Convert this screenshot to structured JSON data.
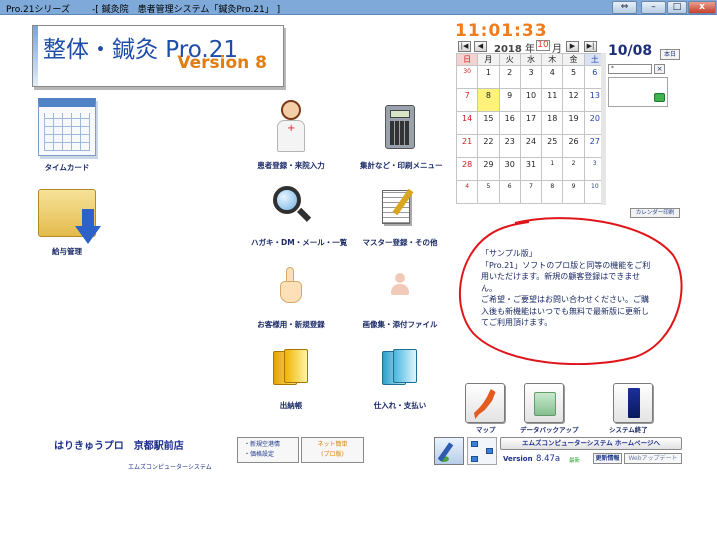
{
  "window": {
    "app_tab": "Pro.21シリーズ",
    "title": "-[ 鍼灸院　患者管理システム「鍼灸Pro.21」 ]",
    "controls": {
      "restore": "⇔",
      "minimize": "–",
      "maximize": "□",
      "close": "x"
    }
  },
  "logo": {
    "title": "整体・鍼灸 Pro.21",
    "version": "Version 8"
  },
  "menu": {
    "timecard": "タイムカード",
    "payroll": "給与管理",
    "patient_registration": "患者登録・来院入力",
    "aggregation_print": "集計など・印刷メニュー",
    "postcard_dm_mail": "ハガキ・DM・メール・一覧",
    "master_registration": "マスター登録・その他",
    "customer_booking": "お客様用・新規登録",
    "image_attachment": "画像集・添付ファイル",
    "ledger": "出納帳",
    "purchase_payment": "仕入れ・支払い"
  },
  "clock": {
    "time": "11:01:33"
  },
  "calendar": {
    "nav": {
      "first": "|◀",
      "prev": "◀",
      "next": "▶",
      "last": "▶|"
    },
    "year": "2018",
    "year_unit": "年",
    "month": "10",
    "month_unit": "月",
    "weekdays": [
      "日",
      "月",
      "火",
      "水",
      "木",
      "金",
      "土"
    ],
    "weeks": [
      [
        {
          "d": "30",
          "small": true
        },
        {
          "d": "1"
        },
        {
          "d": "2"
        },
        {
          "d": "3"
        },
        {
          "d": "4"
        },
        {
          "d": "5"
        },
        {
          "d": "6"
        }
      ],
      [
        {
          "d": "7"
        },
        {
          "d": "8"
        },
        {
          "d": "9"
        },
        {
          "d": "10"
        },
        {
          "d": "11"
        },
        {
          "d": "12"
        },
        {
          "d": "13"
        }
      ],
      [
        {
          "d": "14"
        },
        {
          "d": "15"
        },
        {
          "d": "16"
        },
        {
          "d": "17"
        },
        {
          "d": "18"
        },
        {
          "d": "19"
        },
        {
          "d": "20"
        }
      ],
      [
        {
          "d": "21"
        },
        {
          "d": "22"
        },
        {
          "d": "23"
        },
        {
          "d": "24"
        },
        {
          "d": "25"
        },
        {
          "d": "26"
        },
        {
          "d": "27"
        }
      ],
      [
        {
          "d": "28"
        },
        {
          "d": "29"
        },
        {
          "d": "30"
        },
        {
          "d": "31"
        },
        {
          "d": "1",
          "small": true
        },
        {
          "d": "2",
          "small": true
        },
        {
          "d": "3",
          "small": true
        }
      ],
      [
        {
          "d": "4",
          "small": true
        },
        {
          "d": "5",
          "small": true
        },
        {
          "d": "6",
          "small": true
        },
        {
          "d": "7",
          "small": true
        },
        {
          "d": "8",
          "small": true
        },
        {
          "d": "9",
          "small": true
        },
        {
          "d": "10",
          "small": true
        }
      ]
    ],
    "today_date": "10/08",
    "today_button": "本日",
    "memo_value": "*",
    "memo_clear": "×",
    "print_button": "カレンダー印刷"
  },
  "sample_note": {
    "lines": [
      "「サンプル版」",
      "「Pro.21」ソフトのプロ版と同等の機能をご利用いただけます。新規の顧客登録はできません。",
      "ご希望・ご要望はお問い合わせください。ご購入後も新機能はいつでも無料で最新版に更新してご利用頂けます。"
    ]
  },
  "tools": {
    "map": "マップ",
    "backup": "データバックアップ",
    "exit": "システム終了"
  },
  "footer": {
    "store_name": "はりきゅうプロ　京都駅前店",
    "company": "エムズコンピューターシステム",
    "settings_lines": [
      "・新規空港情",
      "・価格設定"
    ],
    "netbooking_lines": [
      "ネット簡単",
      "(プロ版)"
    ],
    "homepage_button": "エムズコンピューターシステム ホームページへ",
    "version_label": "Version",
    "version_value": "8.47a",
    "version_tag": "最新",
    "update_info_button": "更新情報",
    "web_update_button": "Webアップデート"
  },
  "colors": {
    "accent": "#f07c1c",
    "brand_blue": "#1d4da8",
    "sunday": "#c82222",
    "saturday": "#2442a8",
    "annotation_red": "#e0151a"
  }
}
